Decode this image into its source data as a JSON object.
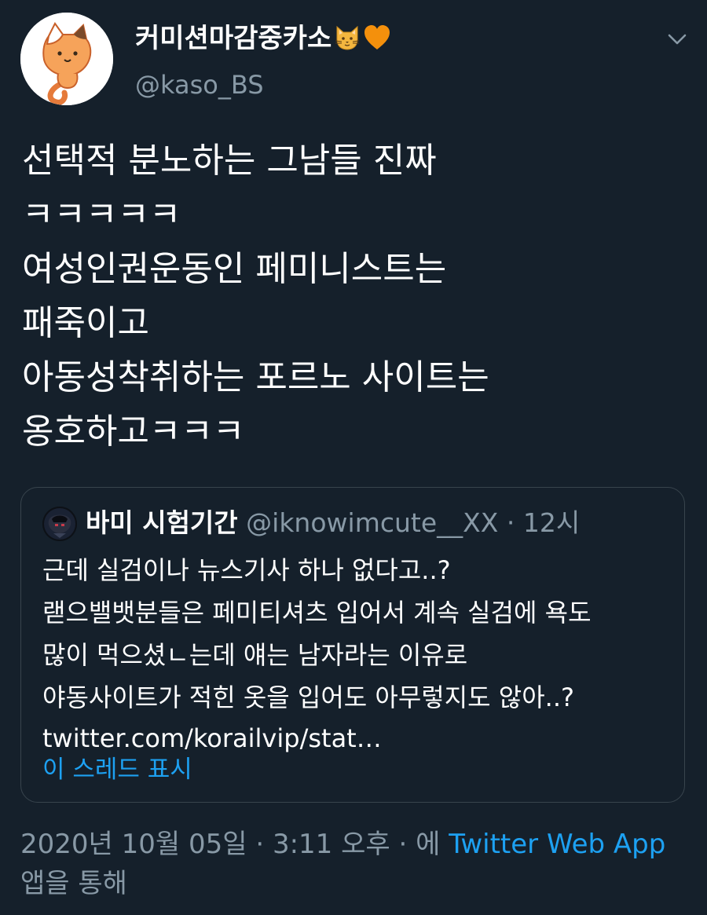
{
  "author": {
    "display_name": "커미션마감중카소",
    "handle": "@kaso_BS",
    "name_emojis": [
      "cat-face-emoji",
      "orange-heart-emoji"
    ]
  },
  "tweet": {
    "text": "선택적 분노하는 그남들 진짜\nㅋㅋㅋㅋㅋ\n여성인권운동인 페미니스트는\n패죽이고\n아동성착취하는 포르노 사이트는\n옹호하고ㅋㅋㅋ"
  },
  "quote": {
    "name": "바미 시험기간",
    "handle": "@iknowimcute__XX",
    "separator": "·",
    "time": "12시",
    "text": "근데 실검이나 뉴스기사 하나 없다고..?\n랟으밸뱃분들은 페미티셔츠 입어서 계속 실검에 욕도\n많이 먹으셨ㄴ는데 얘는 남자라는 이유로\n야동사이트가 적힌 옷을 입어도 아무렇지도 않아..?",
    "link": "twitter.com/korailvip/stat…",
    "show_thread": "이 스레드 표시"
  },
  "meta": {
    "date": "2020년 10월 05일",
    "sep1": "·",
    "time": "3:11 오후",
    "sep2": "·",
    "via_prefix": "에",
    "source": "Twitter Web App",
    "via_suffix": "앱을 통해"
  },
  "colors": {
    "background": "#15202b",
    "secondary_text": "#8899a6",
    "link": "#1da1f2",
    "border": "#38444d"
  }
}
